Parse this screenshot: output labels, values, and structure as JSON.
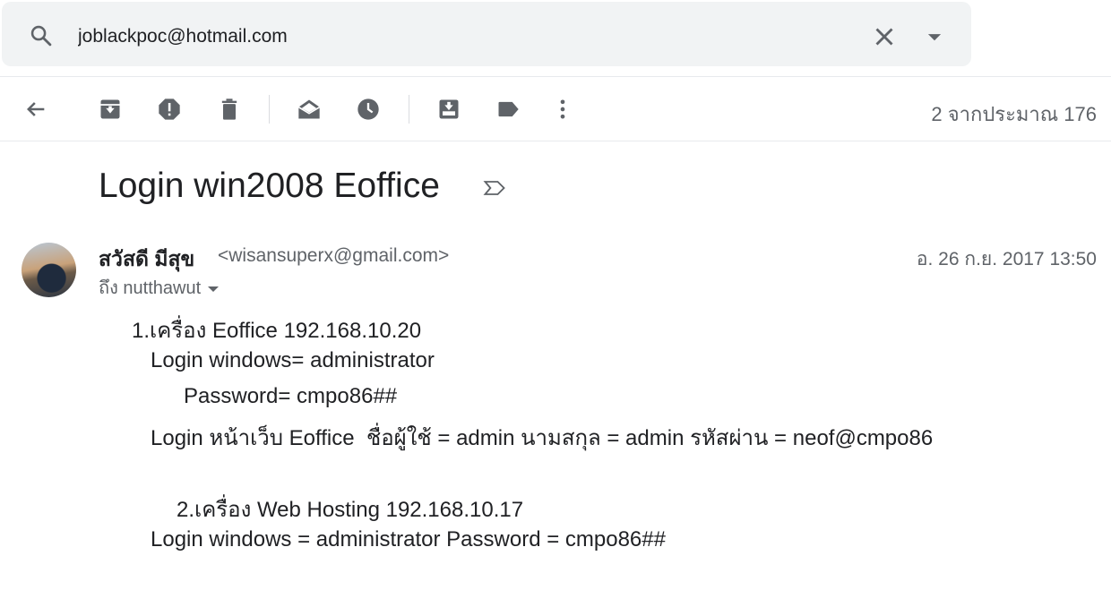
{
  "search": {
    "value": "joblackpoc@hotmail.com",
    "search_icon": "search-icon",
    "clear_icon": "close-icon",
    "options_icon": "caret-down-icon"
  },
  "toolbar": {
    "icons": [
      "back-arrow-icon",
      "archive-icon",
      "report-spam-icon",
      "delete-icon",
      "mark-unread-icon",
      "snooze-icon",
      "move-to-icon",
      "label-icon",
      "more-vert-icon"
    ],
    "counter": "2 จากประมาณ 176"
  },
  "message": {
    "subject": "Login win2008 Eoffice",
    "sender_name": "สวัสดี มีสุข",
    "sender_email": "<wisansuperx@gmail.com>",
    "date": "อ. 26 ก.ย. 2017 13:50",
    "to": "ถึง nutthawut",
    "body_lines": [
      "1.เครื่อง Eoffice 192.168.10.20",
      "Login windows= administrator",
      "Password= cmpo86##",
      "Login หน้าเว็บ Eoffice  ชื่อผู้ใช้ = admin นามสกุล = admin รหัสผ่าน = neof@cmpo86",
      "2.เครื่อง Web Hosting 192.168.10.17",
      "Login windows = administrator Password = cmpo86##"
    ]
  },
  "colors": {
    "text": "#202124",
    "secondary": "#5f6368",
    "search_bg": "#f1f3f4"
  }
}
